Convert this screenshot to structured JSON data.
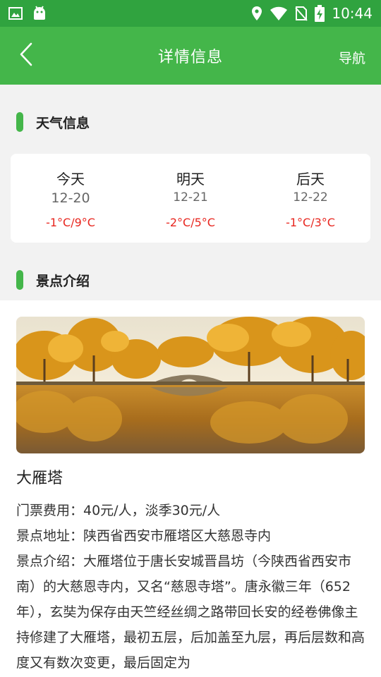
{
  "status_bar": {
    "time": "10:44"
  },
  "app_bar": {
    "title": "详情信息",
    "nav_label": "导航"
  },
  "weather_section": {
    "title": "天气信息"
  },
  "weather": [
    {
      "day": "今天",
      "date": "12-20",
      "temp": "-1°C/9°C"
    },
    {
      "day": "明天",
      "date": "12-21",
      "temp": "-2°C/5°C"
    },
    {
      "day": "后天",
      "date": "12-22",
      "temp": "-1°C/3°C"
    }
  ],
  "intro_section": {
    "title": "景点介绍"
  },
  "spot": {
    "name": "大雁塔",
    "ticket": "门票费用：40元/人，淡季30元/人",
    "address": "景点地址：陕西省西安市雁塔区大慈恩寺内",
    "description": "景点介绍：大雁塔位于唐长安城晋昌坊（今陕西省西安市南）的大慈恩寺内，又名“慈恩寺塔”。唐永徽三年（652年），玄奘为保存由天竺经丝绸之路带回长安的经卷佛像主持修建了大雁塔，最初五层，后加盖至九层，再后层数和高度又有数次变更，最后固定为"
  },
  "colors": {
    "status_bar": "#30a33f",
    "app_bar": "#44b64a",
    "accent": "#44b64a",
    "temp": "#e8261f"
  }
}
